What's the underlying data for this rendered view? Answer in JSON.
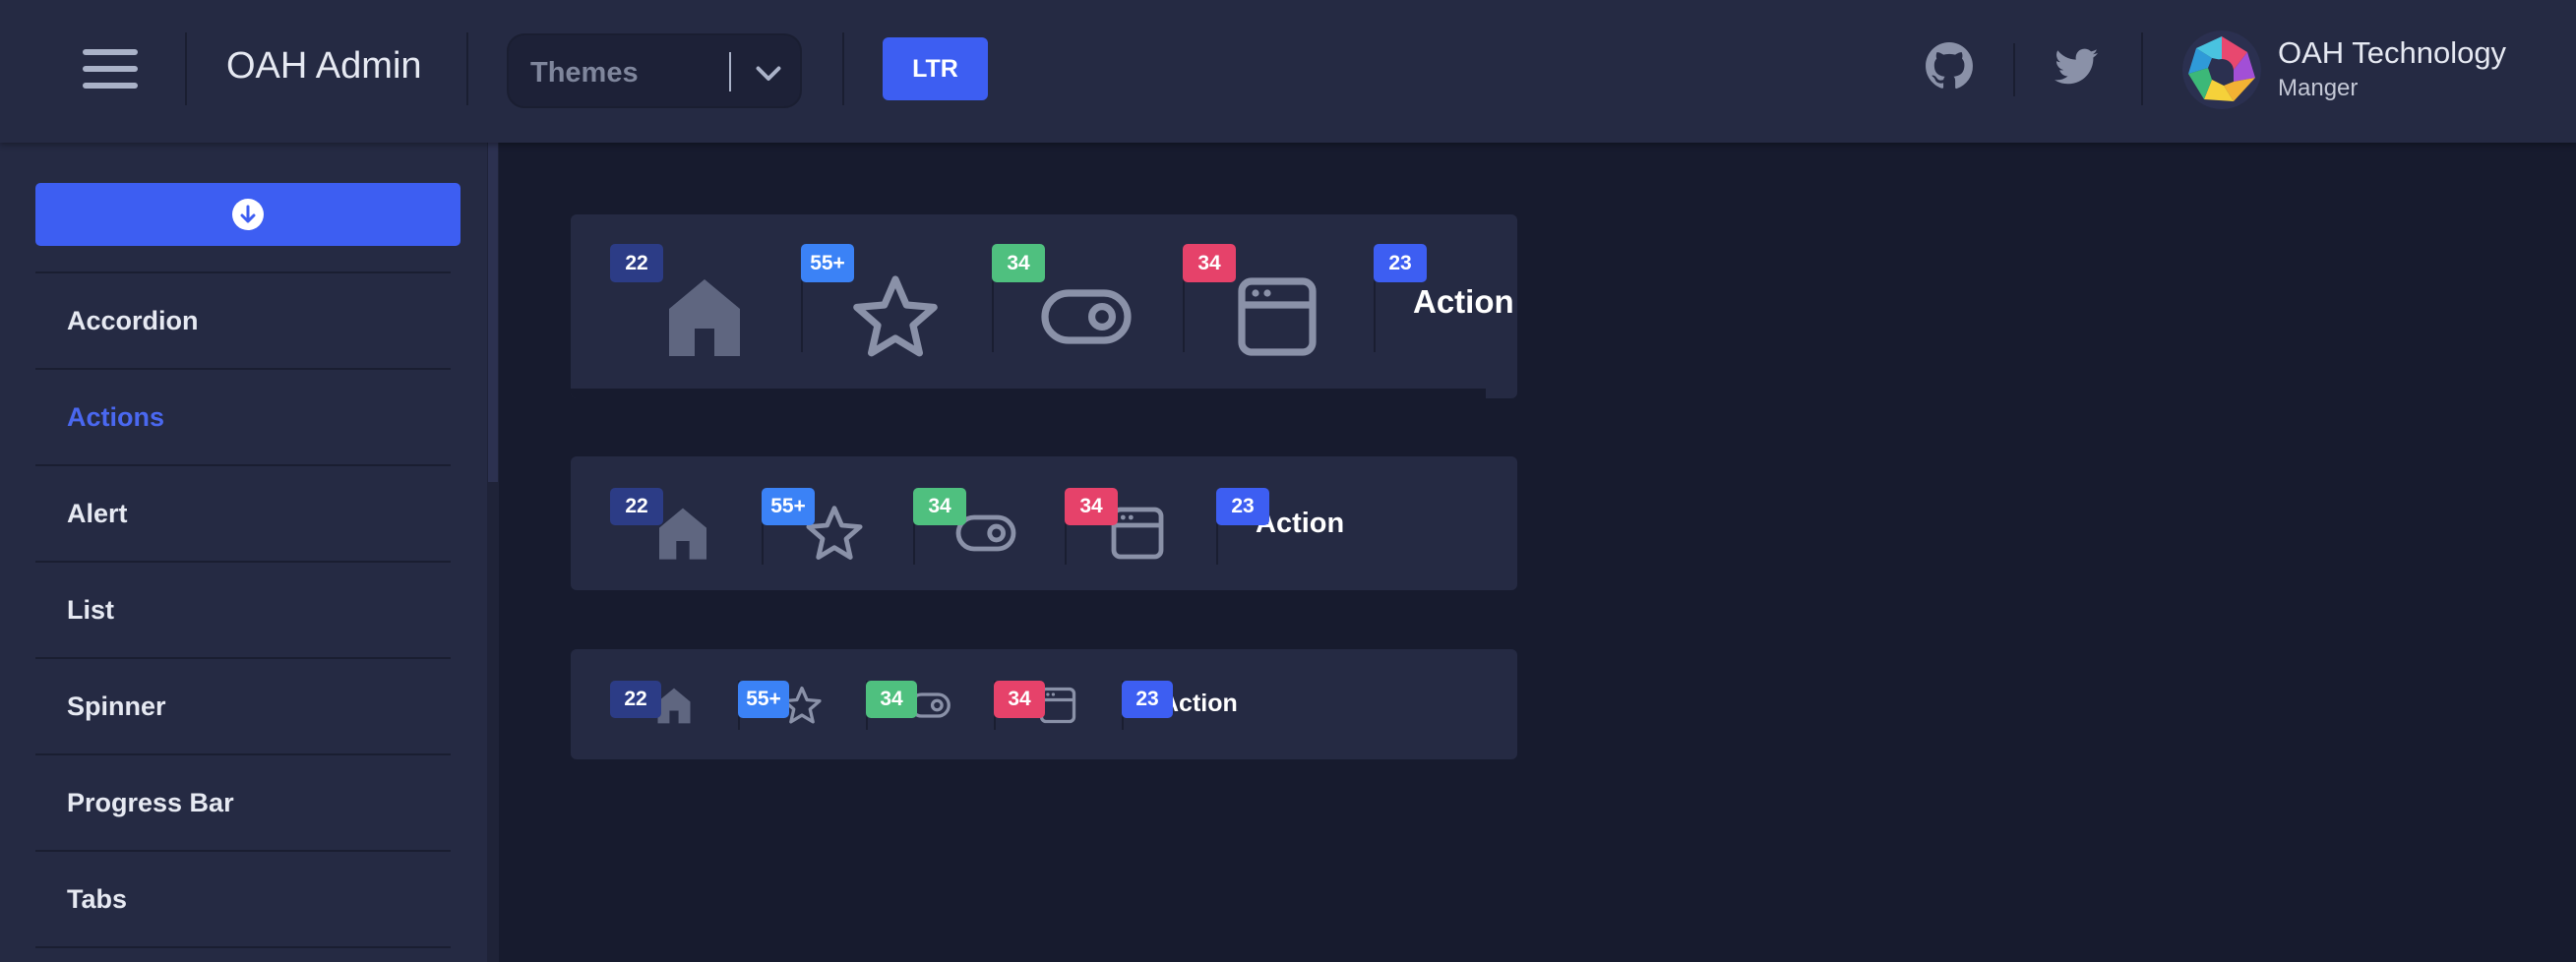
{
  "header": {
    "title": "OAH Admin",
    "theme_select": {
      "value": "Themes"
    },
    "direction_button": "LTR",
    "user": {
      "name": "OAH Technology",
      "role": "Manger"
    }
  },
  "sidebar": {
    "items": [
      {
        "label": "Accordion",
        "active": false
      },
      {
        "label": "Actions",
        "active": true
      },
      {
        "label": "Alert",
        "active": false
      },
      {
        "label": "List",
        "active": false
      },
      {
        "label": "Spinner",
        "active": false
      },
      {
        "label": "Progress Bar",
        "active": false
      },
      {
        "label": "Tabs",
        "active": false
      }
    ]
  },
  "action_groups": [
    {
      "size": "large",
      "actions": [
        {
          "icon": "home-icon",
          "badge": "22",
          "badge_color": "#2c3c86"
        },
        {
          "icon": "star-icon",
          "badge": "55+",
          "badge_color": "#3b82f6"
        },
        {
          "icon": "toggle-icon",
          "badge": "34",
          "badge_color": "#4fc07f"
        },
        {
          "icon": "browser-window-icon",
          "badge": "34",
          "badge_color": "#e6426a"
        },
        {
          "icon": "",
          "badge": "23",
          "badge_color": "#3d5ef2",
          "label": "Action"
        }
      ]
    },
    {
      "size": "medium",
      "actions": [
        {
          "icon": "home-icon",
          "badge": "22",
          "badge_color": "#2c3c86"
        },
        {
          "icon": "star-icon",
          "badge": "55+",
          "badge_color": "#3b82f6"
        },
        {
          "icon": "toggle-icon",
          "badge": "34",
          "badge_color": "#4fc07f"
        },
        {
          "icon": "browser-window-icon",
          "badge": "34",
          "badge_color": "#e6426a"
        },
        {
          "icon": "",
          "badge": "23",
          "badge_color": "#3d5ef2",
          "label": "Action"
        }
      ]
    },
    {
      "size": "small",
      "actions": [
        {
          "icon": "home-icon",
          "badge": "22",
          "badge_color": "#2c3c86"
        },
        {
          "icon": "star-icon",
          "badge": "55+",
          "badge_color": "#3b82f6"
        },
        {
          "icon": "toggle-icon",
          "badge": "34",
          "badge_color": "#4fc07f"
        },
        {
          "icon": "browser-window-icon",
          "badge": "34",
          "badge_color": "#e6426a"
        },
        {
          "icon": "",
          "badge": "23",
          "badge_color": "#3d5ef2",
          "label": "Action"
        }
      ]
    }
  ],
  "colors": {
    "accent": "#3d5ef2",
    "header_bg": "#252a43",
    "page_bg": "#171b2e",
    "icon_color": "#8a91a8",
    "home_icon_color": "#5f6680"
  }
}
